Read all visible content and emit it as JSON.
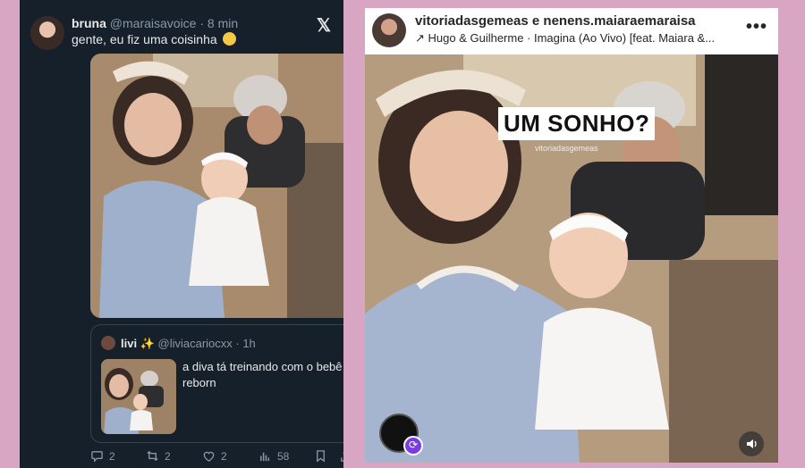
{
  "tweet": {
    "author_name": "bruna",
    "author_meta": "@maraisavoice · 8 min",
    "text": "gente, eu fiz uma coisinha",
    "emoji_icon": "pleading-face-emoji",
    "quote": {
      "author_name": "livi ✨",
      "author_meta": "@liviacariocxx · 1h",
      "text": "a diva tá treinando com o bebê reborn"
    },
    "actions": {
      "replies": "2",
      "retweets": "2",
      "likes": "2",
      "views": "58"
    }
  },
  "story": {
    "username": "vitoriadasgemeas e nenens.maiaraemaraisa",
    "music": "↗ Hugo & Guilherme · Imagina (Ao Vivo) [feat. Maiara &...",
    "sticker_text": "UM SONHO?",
    "watermark": "vitoriadasgemeas"
  },
  "colors": {
    "background": "#d8a6c2",
    "tweet_bg": "#15202b",
    "tweet_muted": "#8b98a5",
    "story_share": "#7b3ce6"
  }
}
